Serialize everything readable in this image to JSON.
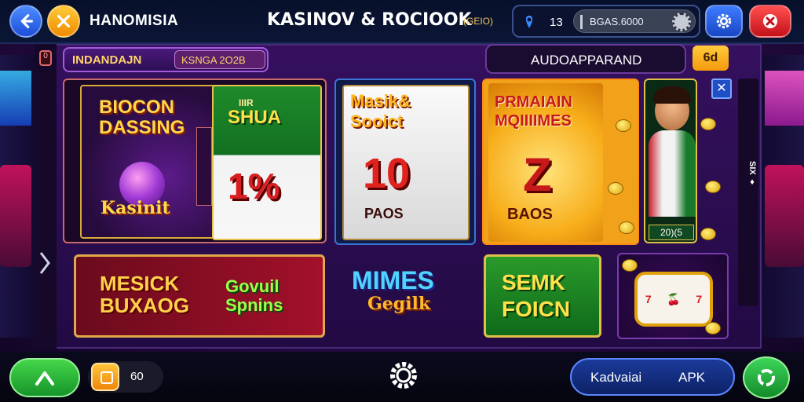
{
  "header": {
    "app_title": "HANOMISIA",
    "center_title": "KASINOV & ROCIOOK",
    "center_badge": "(GEIO)",
    "notification_count": "13",
    "balance": "BGAS.6000"
  },
  "tabs": {
    "primary_label": "INDANDAJN",
    "secondary_label": "KSNGA  2O2B"
  },
  "search": {
    "label": "AUDOAPPARAND",
    "tag": "6d"
  },
  "side_rail": {
    "left_chip": "0",
    "right_text": "SIX ♦"
  },
  "tiles": {
    "promo_left_title": "BIOCON DASSING",
    "promo_left_sub": "Kasinit",
    "promo_green_label": "IIIR",
    "promo_green_title": "SHUA",
    "promo_green_value": "1%",
    "mid_title": "Masik& Sooict",
    "mid_value": "10",
    "mid_sub": "PAOS",
    "gold_title": "PRMAIAIN MQIIIIMES",
    "gold_value": "Z",
    "gold_sub": "BAOS",
    "host_year": "20)(5",
    "bottom1_title": "MESICK BUXAOG",
    "bottom1_sub": "Govuil Spnins",
    "bottom2_title": "MIMES",
    "bottom2_sub": "Gegilk",
    "bottom3_title": "SEMK FOICN",
    "reel_symbols": [
      "7",
      "🍒",
      "7"
    ]
  },
  "bottom": {
    "coin_value": "60",
    "apk_left": "Kadvaiai",
    "apk_right": "APK"
  },
  "colors": {
    "accent_blue": "#1c4fd8",
    "accent_gold": "#f59a0c",
    "accent_red": "#c4121b",
    "accent_green": "#16952a",
    "background": "#2b0b4a"
  }
}
